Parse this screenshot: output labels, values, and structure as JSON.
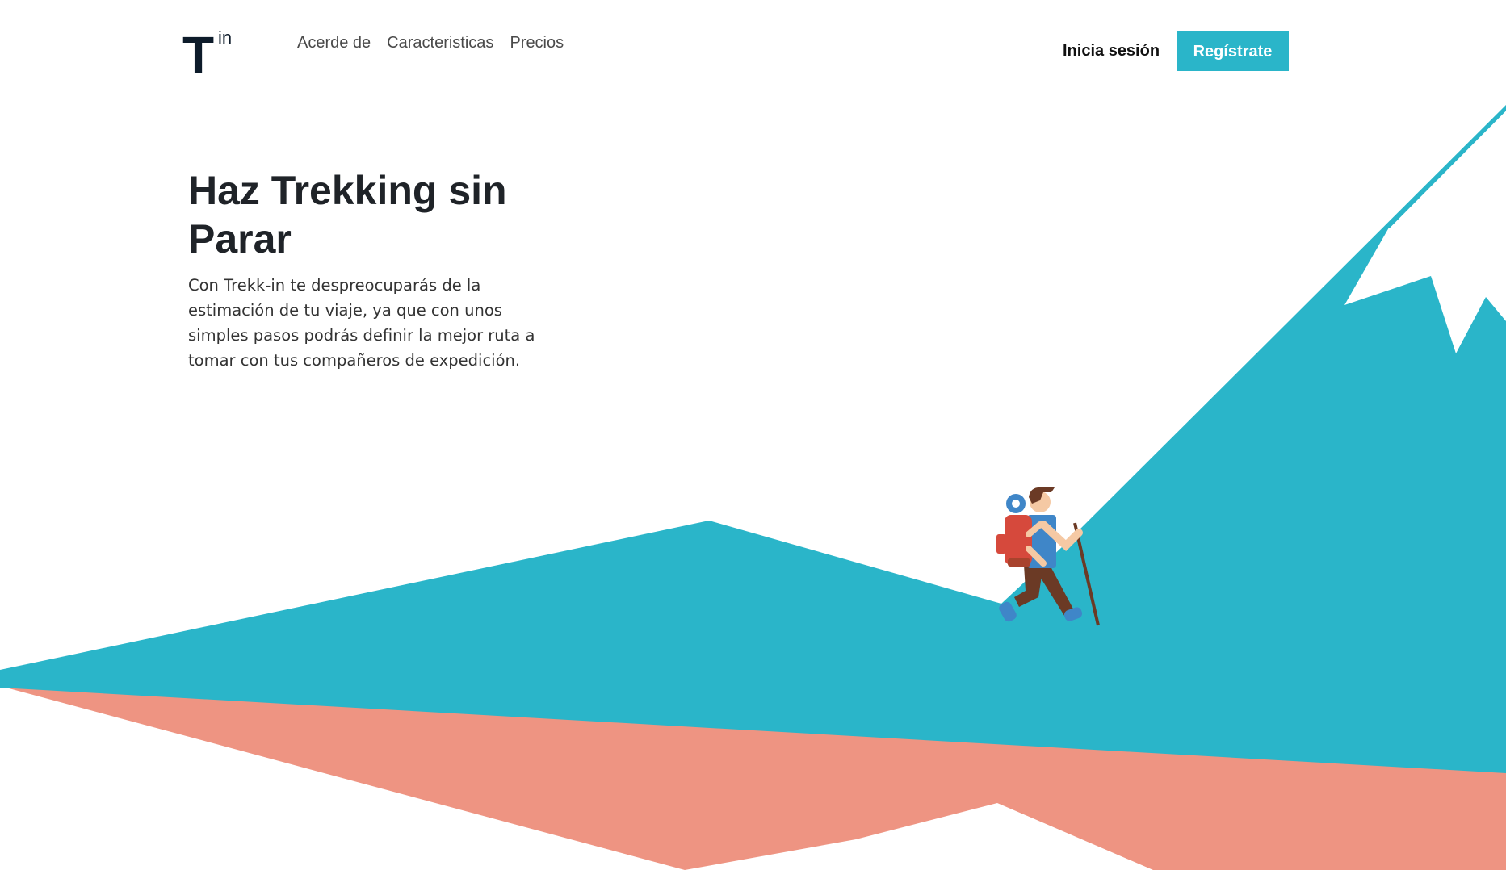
{
  "header": {
    "logo_letter": "T",
    "logo_suffix": "in",
    "nav": [
      {
        "label": "Acerde de"
      },
      {
        "label": "Caracteristicas"
      },
      {
        "label": "Precios"
      }
    ],
    "login_label": "Inicia sesión",
    "signup_label": "Regístrate"
  },
  "hero": {
    "title": "Haz Trekking sin Parar",
    "description": "Con Trekk-in te despreocuparás de la estimación de tu viaje, ya que con unos simples pasos podrás definir la mejor ruta a tomar con tus compañeros de expedición."
  },
  "colors": {
    "accent": "#2ab5c9",
    "mountain": "#2ab5c9",
    "ground": "#ee9482",
    "text_dark": "#1f2328"
  },
  "illustration": {
    "icons": [
      "mountain-illustration",
      "hiker-icon"
    ]
  }
}
